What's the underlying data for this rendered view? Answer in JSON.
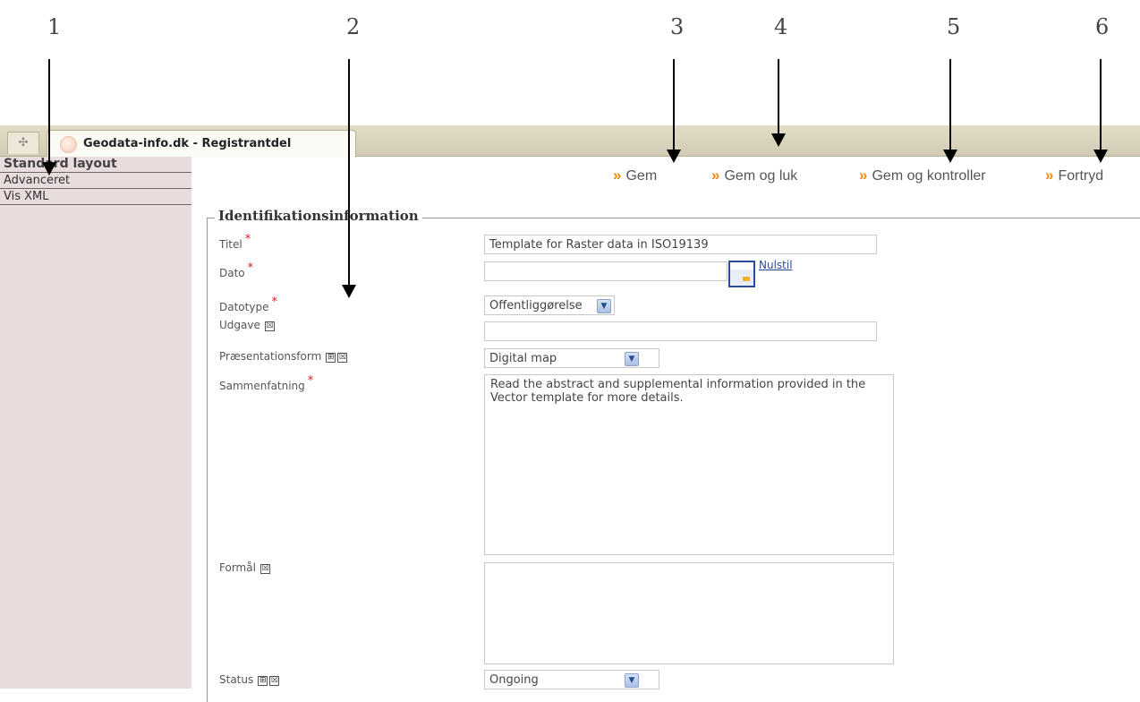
{
  "annotations": [
    "1",
    "2",
    "3",
    "4",
    "5",
    "6"
  ],
  "browser": {
    "tab_title": "Geodata-info.dk - Registrantdel",
    "new_tab_symbol": "✣"
  },
  "leftnav": {
    "items": [
      "Standard layout",
      "Advanceret",
      "Vis XML"
    ]
  },
  "toolbar": {
    "chevron": "»",
    "buttons": [
      "Gem",
      "Gem og luk",
      "Gem og kontroller",
      "Fortryd"
    ],
    "accent": "#f08a00"
  },
  "form": {
    "legend": "Identifikationsinformation",
    "required_mark": "*",
    "remove_icon": "☒",
    "add_icon": "⊞",
    "fields": {
      "titel": {
        "label": "Titel",
        "value": "Template for Raster data in ISO19139"
      },
      "dato": {
        "label": "Dato",
        "value": "",
        "reset_link": "Nulstil"
      },
      "datotype": {
        "label": "Datotype",
        "value": "Offentliggørelse"
      },
      "udgave": {
        "label": "Udgave",
        "value": ""
      },
      "praesentationsform": {
        "label": "Præsentationsform",
        "value": "Digital map"
      },
      "sammenfatning": {
        "label": "Sammenfatning",
        "value": "Read the abstract and supplemental information provided in the Vector template for more details."
      },
      "formaal": {
        "label": "Formål",
        "value": ""
      },
      "status": {
        "label": "Status",
        "value": "Ongoing"
      }
    }
  },
  "colors": {
    "nav_background": "#e8dcdc",
    "required": "#d02020",
    "link": "#2a4d9a"
  }
}
